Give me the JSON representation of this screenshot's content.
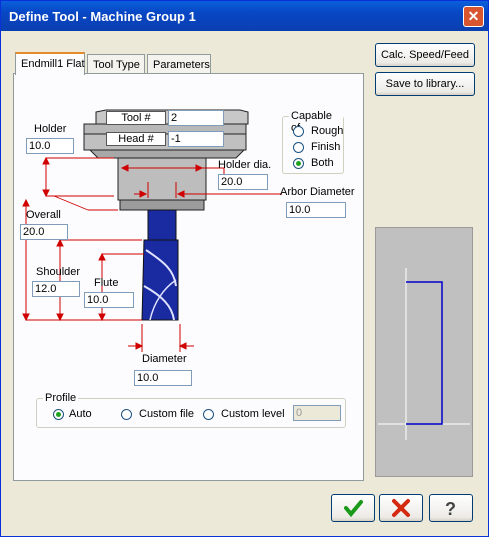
{
  "window": {
    "title": "Define Tool - Machine Group 1"
  },
  "tabs": [
    {
      "label": "Endmill1 Flat"
    },
    {
      "label": "Tool Type"
    },
    {
      "label": "Parameters"
    }
  ],
  "buttons": {
    "calc": "Calc. Speed/Feed",
    "save": "Save to library..."
  },
  "fields": {
    "tool_num_label": "Tool #",
    "tool_num": "2",
    "head_num_label": "Head #",
    "head_num": "-1",
    "holder_label": "Holder",
    "holder": "10.0",
    "holder_dia_label": "Holder dia.",
    "holder_dia": "20.0",
    "arbor_label": "Arbor Diameter",
    "arbor": "10.0",
    "overall_label": "Overall",
    "overall": "20.0",
    "shoulder_label": "Shoulder",
    "shoulder": "12.0",
    "flute_label": "Flute",
    "flute": "10.0",
    "diameter_label": "Diameter",
    "diameter": "10.0"
  },
  "capable": {
    "title": "Capable of",
    "options": [
      "Rough",
      "Finish",
      "Both"
    ],
    "selected": "Both"
  },
  "profile": {
    "title": "Profile",
    "options": [
      "Auto",
      "Custom file",
      "Custom level"
    ],
    "selected": "Auto",
    "level_value": "0"
  },
  "colors": {
    "accent": "#0a5fdb",
    "tool_blue": "#1a2aa0",
    "ok_green": "#1a9a1a",
    "cancel_red": "#d42a10",
    "dimension_red": "#d00000"
  }
}
